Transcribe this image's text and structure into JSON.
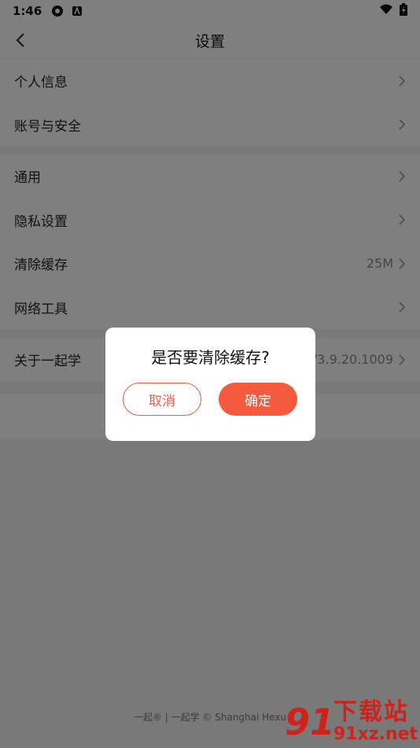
{
  "status_bar": {
    "time": "1:46"
  },
  "header": {
    "title": "设置"
  },
  "groups": [
    {
      "items": [
        {
          "label": "个人信息"
        },
        {
          "label": "账号与安全"
        }
      ]
    },
    {
      "items": [
        {
          "label": "通用"
        },
        {
          "label": "隐私设置"
        },
        {
          "label": "清除缓存",
          "value": "25M"
        },
        {
          "label": "网络工具"
        }
      ]
    },
    {
      "items": [
        {
          "label": "关于一起学",
          "value": "V3.9.20.1009"
        }
      ]
    }
  ],
  "footer": {
    "text": "一起® | 一起学 © Shanghai Hexu"
  },
  "dialog": {
    "message": "是否要清除缓存?",
    "cancel_label": "取消",
    "confirm_label": "确定"
  },
  "watermark": {
    "logo": "91",
    "big": "下载站",
    "small": "91xz.net"
  },
  "colors": {
    "accent": "#f45a3e",
    "watermark": "#d0211b"
  }
}
